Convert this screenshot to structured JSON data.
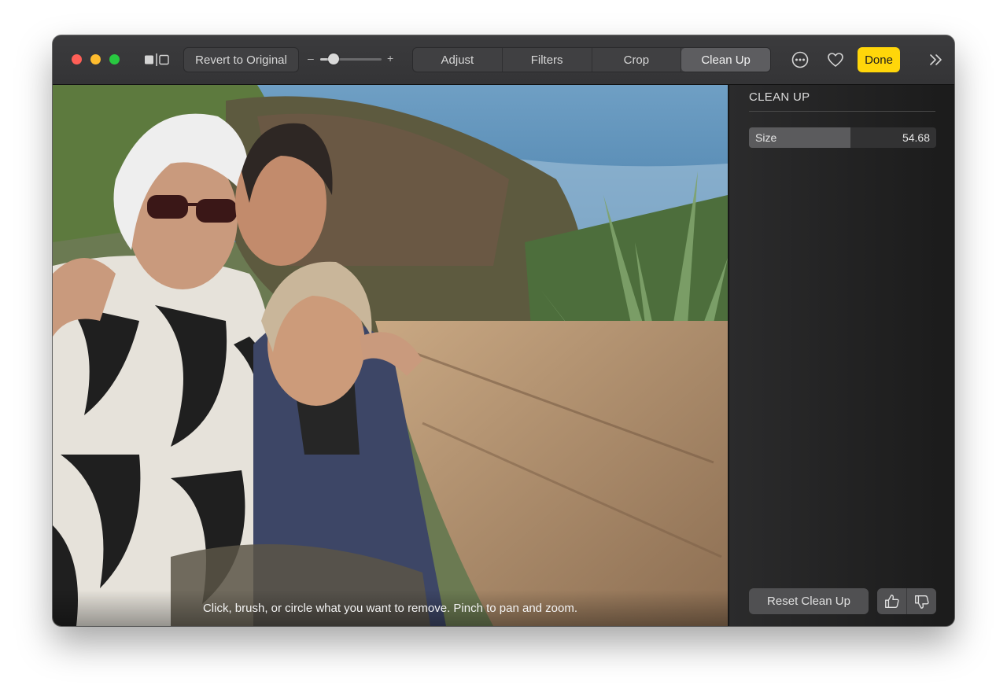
{
  "toolbar": {
    "revert_label": "Revert to Original",
    "zoom_minus": "–",
    "zoom_plus": "+",
    "zoom_level": 0.22,
    "tabs": [
      {
        "label": "Adjust",
        "active": false
      },
      {
        "label": "Filters",
        "active": false
      },
      {
        "label": "Crop",
        "active": false
      },
      {
        "label": "Clean Up",
        "active": true
      }
    ],
    "more_icon": "ellipsis-circle-icon",
    "favorite_icon": "heart-icon",
    "done_label": "Done",
    "expand_icon": "double-chevron-right-icon"
  },
  "photo": {
    "hint": "Click, brush, or circle what you want to remove. Pinch to pan and zoom."
  },
  "panel": {
    "title": "CLEAN UP",
    "size_label": "Size",
    "size_value": "54.68",
    "size_fraction": 0.54,
    "reset_label": "Reset Clean Up",
    "thumbs_up_icon": "thumbs-up-icon",
    "thumbs_down_icon": "thumbs-down-icon"
  },
  "colors": {
    "done": "#ffd60a",
    "close": "#ff5f57",
    "minimize": "#febc2e",
    "zoom": "#28c840"
  }
}
